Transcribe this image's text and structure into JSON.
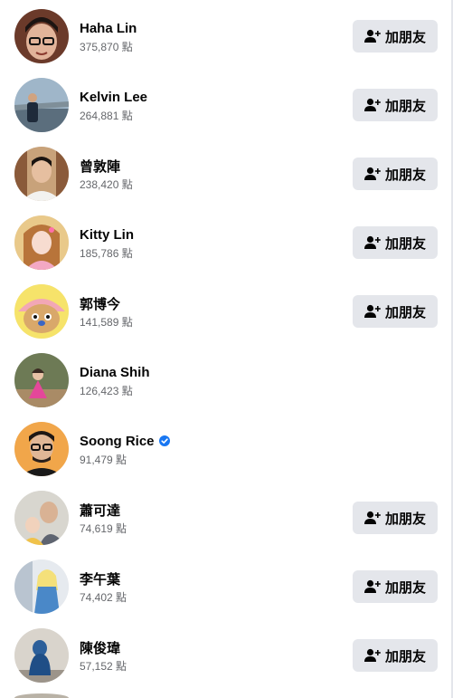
{
  "button_label": "加朋友",
  "colors": {
    "button_bg": "#e4e6eb",
    "text_primary": "#050505",
    "text_secondary": "#65676b",
    "verified": "#1877f2"
  },
  "people": [
    {
      "name": "Haha Lin",
      "points": "375,870 點",
      "has_add_button": true,
      "verified": false
    },
    {
      "name": "Kelvin Lee",
      "points": "264,881 點",
      "has_add_button": true,
      "verified": false
    },
    {
      "name": "曾敦陣",
      "points": "238,420 點",
      "has_add_button": true,
      "verified": false
    },
    {
      "name": "Kitty Lin",
      "points": "185,786 點",
      "has_add_button": true,
      "verified": false
    },
    {
      "name": "郭博今",
      "points": "141,589 點",
      "has_add_button": true,
      "verified": false
    },
    {
      "name": "Diana Shih",
      "points": "126,423 點",
      "has_add_button": false,
      "verified": false
    },
    {
      "name": "Soong Rice",
      "points": "91,479 點",
      "has_add_button": false,
      "verified": true
    },
    {
      "name": "蕭可達",
      "points": "74,619 點",
      "has_add_button": true,
      "verified": false
    },
    {
      "name": "李午葉",
      "points": "74,402 點",
      "has_add_button": true,
      "verified": false
    },
    {
      "name": "陳俊瑋",
      "points": "57,152 點",
      "has_add_button": true,
      "verified": false
    }
  ]
}
